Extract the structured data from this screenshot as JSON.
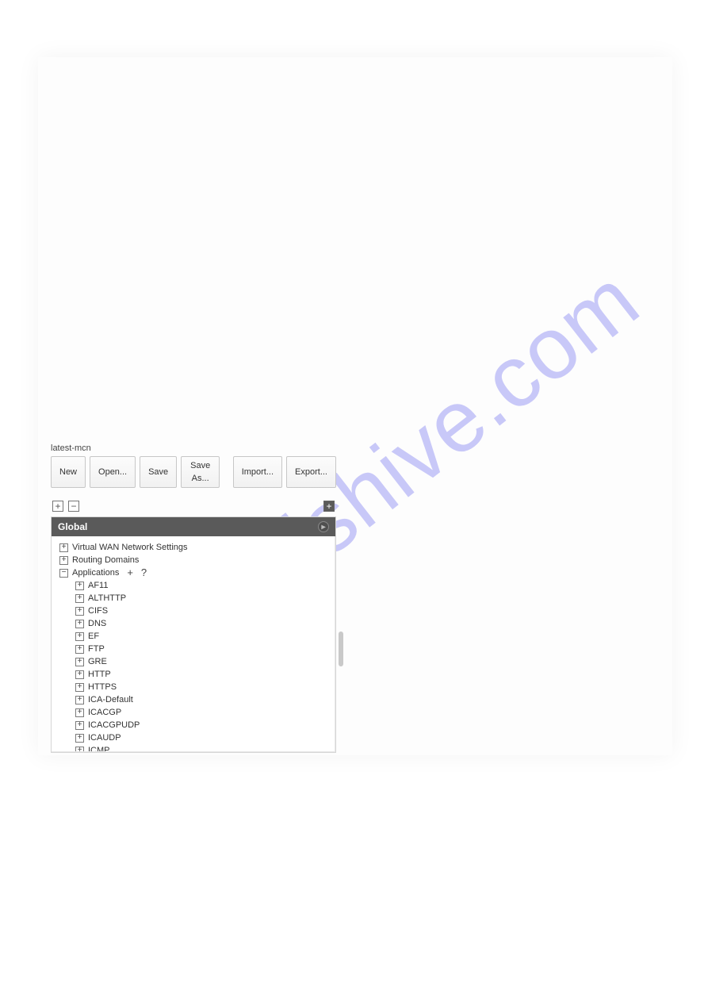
{
  "watermark": "manualshive.com",
  "filename": "latest-mcn",
  "toolbar": {
    "new": "New",
    "open": "Open...",
    "save": "Save",
    "saveas": "Save As...",
    "import": "Import...",
    "export": "Export..."
  },
  "panel": {
    "title": "Global"
  },
  "tree": {
    "top": [
      {
        "label": "Virtual WAN Network Settings",
        "icon": "+"
      },
      {
        "label": "Routing Domains",
        "icon": "+"
      },
      {
        "label": "Applications",
        "icon": "−",
        "add": true
      }
    ],
    "apps": [
      "AF11",
      "ALTHTTP",
      "CIFS",
      "DNS",
      "EF",
      "FTP",
      "GRE",
      "HTTP",
      "HTTPS",
      "ICA-Default",
      "ICACGP",
      "ICACGPUDP",
      "ICAUDP",
      "ICMP"
    ]
  },
  "glyphs": {
    "plus": "+",
    "minus": "−",
    "help": "?",
    "arrow": "▸"
  }
}
